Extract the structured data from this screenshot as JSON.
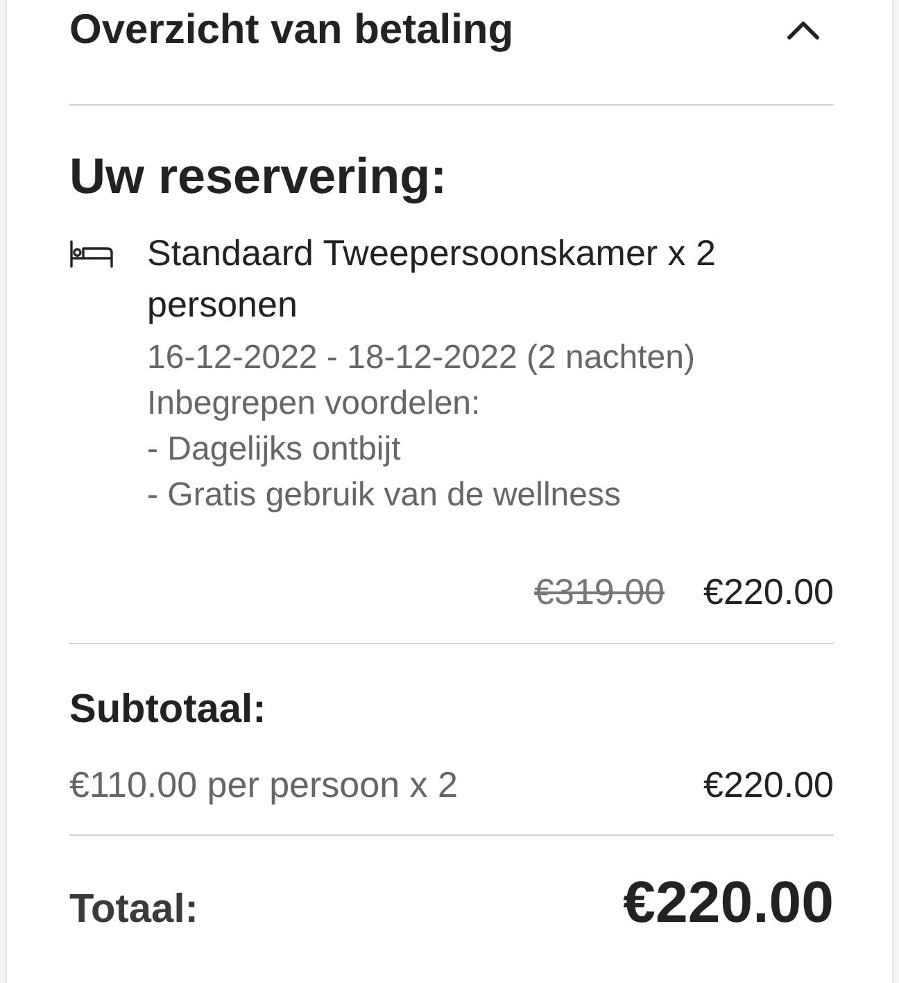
{
  "panel": {
    "title": "Overzicht van betaling",
    "expanded": true
  },
  "reservation": {
    "heading": "Uw reservering:",
    "items": [
      {
        "name": "Standaard Tweepersoonskamer x 2 personen",
        "details": [
          "16-12-2022 - 18-12-2022 (2 nachten)",
          "Inbegrepen voordelen:",
          "- Dagelijks ontbijt",
          "- Gratis gebruik van de wellness"
        ],
        "old_price": "€319.00",
        "price": "€220.00"
      }
    ]
  },
  "subtotal": {
    "heading": "Subtotaal:",
    "lines": [
      {
        "label": "€110.00 per persoon x 2",
        "amount": "€220.00"
      }
    ]
  },
  "total": {
    "label": "Totaal:",
    "amount": "€220.00"
  }
}
